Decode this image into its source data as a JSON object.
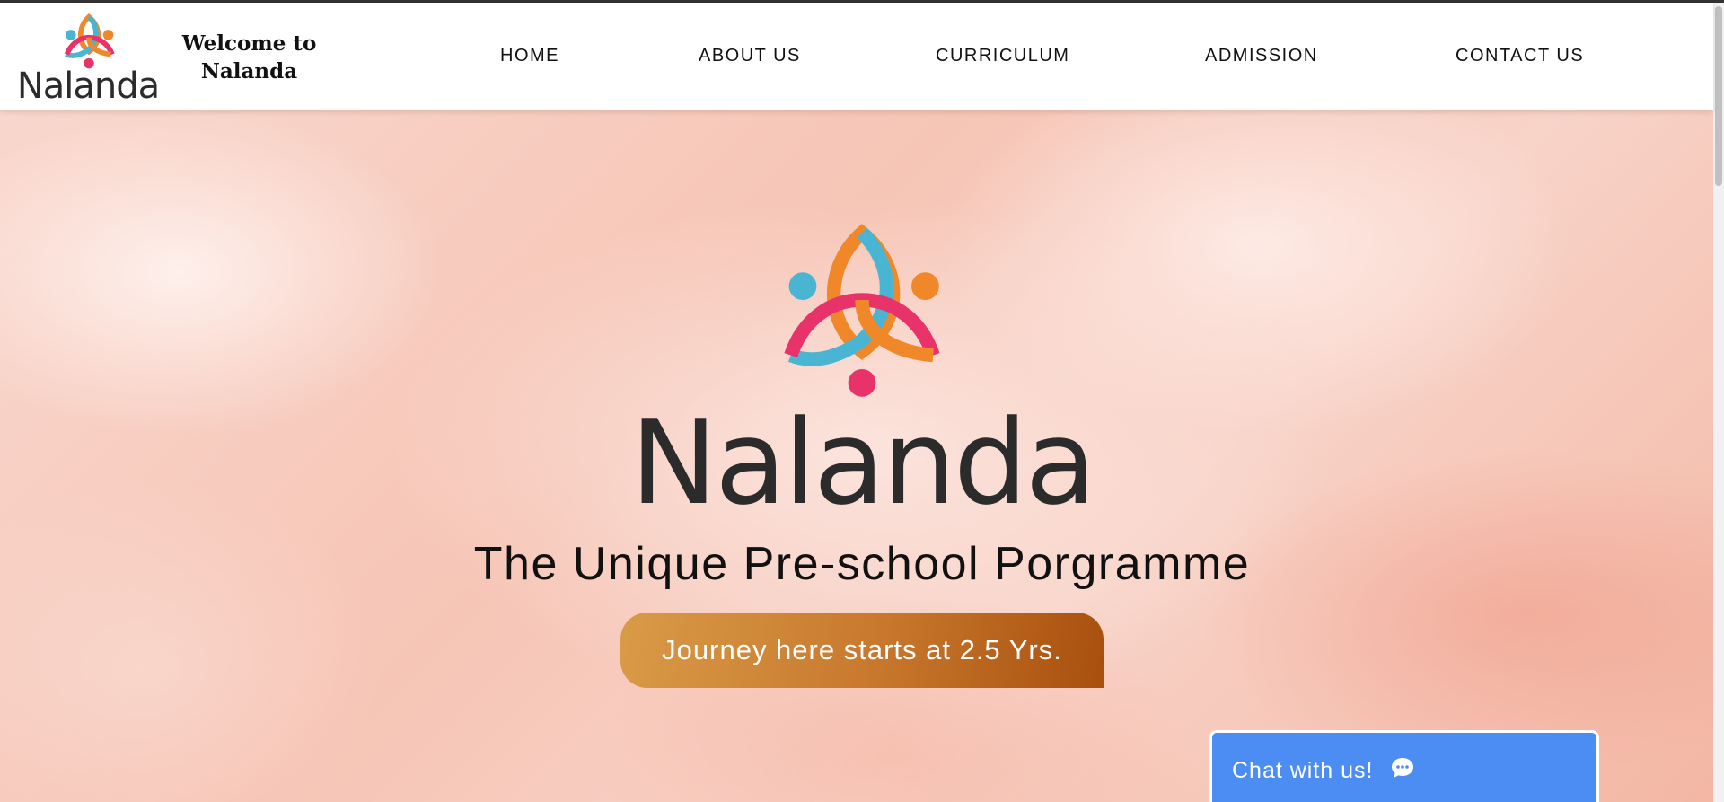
{
  "brand": {
    "name": "Nalanda",
    "welcome_text": "Welcome to Nalanda",
    "colors": {
      "teal": "#4ab4d3",
      "orange": "#f0882a",
      "pink": "#e8336a",
      "text_dark": "#2b2b2b"
    }
  },
  "nav": {
    "items": [
      {
        "label": "HOME"
      },
      {
        "label": "ABOUT US"
      },
      {
        "label": "CURRICULUM"
      },
      {
        "label": "ADMISSION"
      },
      {
        "label": "CONTACT US"
      }
    ]
  },
  "hero": {
    "wordmark": "Nalanda",
    "tagline": "The Unique Pre-school Porgramme",
    "cta_label": "Journey here starts at 2.5 Yrs."
  },
  "chat": {
    "label": "Chat with us!",
    "icon": "chat-bubble-icon",
    "color": "#4b8df3"
  }
}
